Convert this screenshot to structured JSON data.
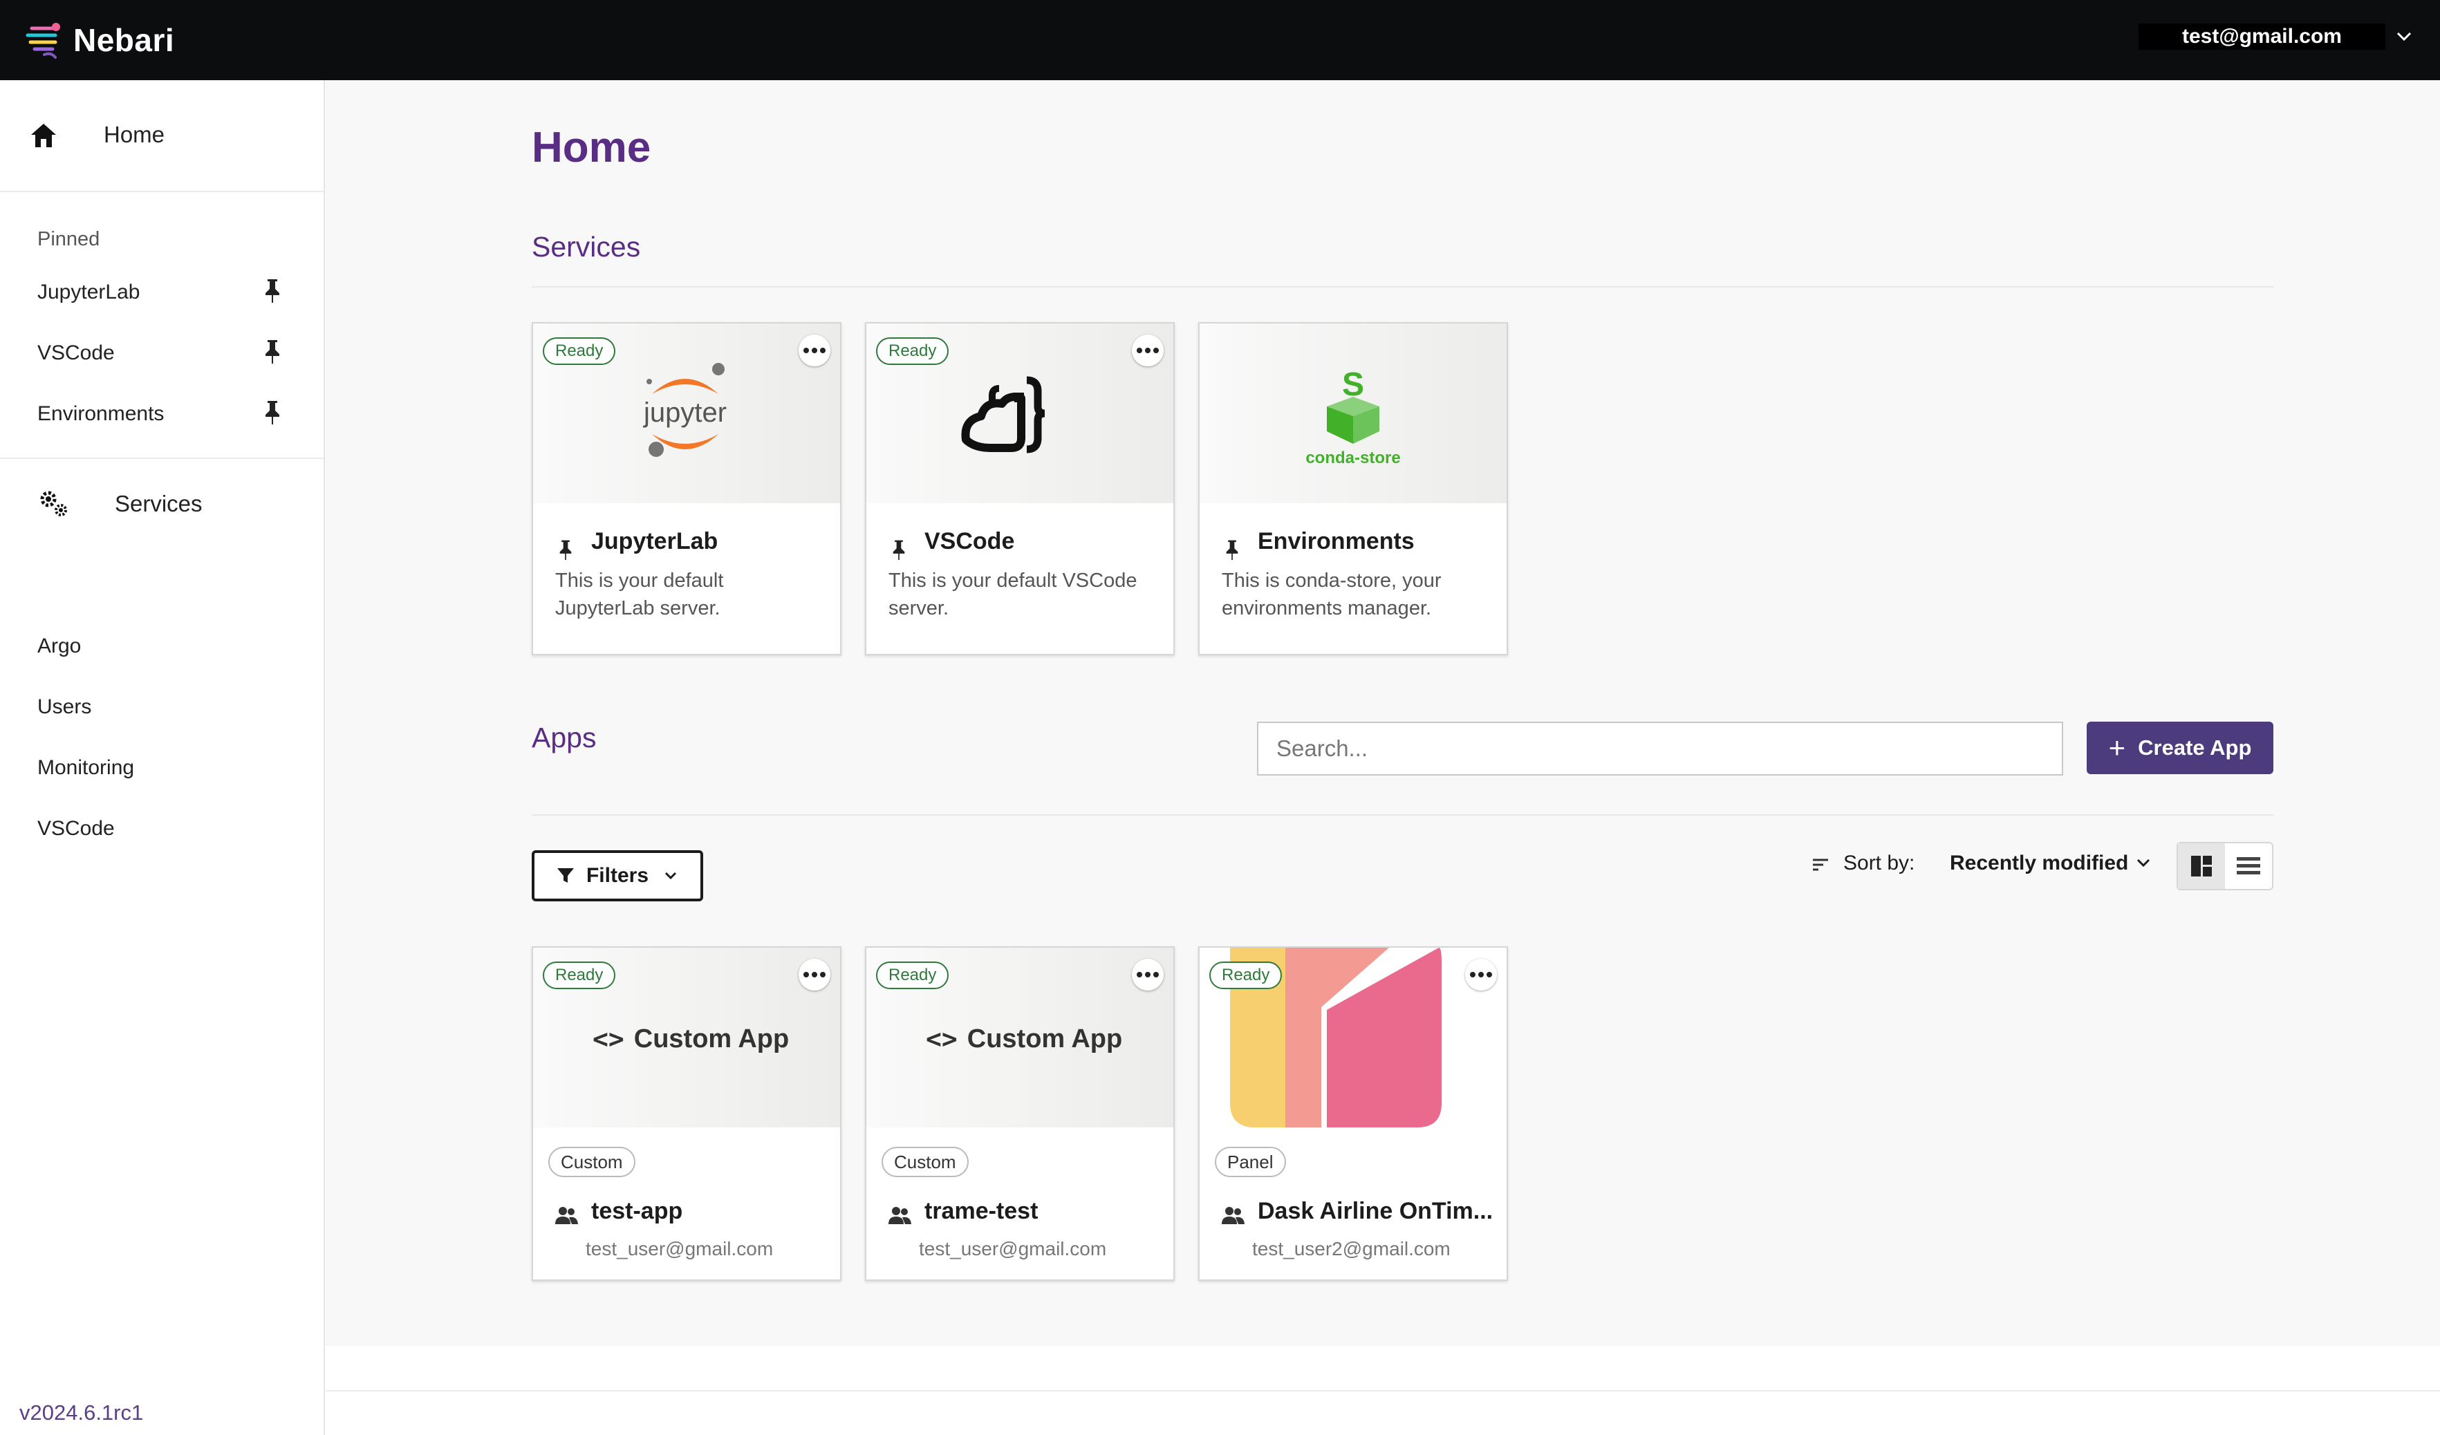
{
  "app": {
    "brand": "Nebari",
    "user_email": "test@gmail.com",
    "version": "v2024.6.1rc1"
  },
  "sidebar": {
    "home_label": "Home",
    "pinned_title": "Pinned",
    "pinned": [
      {
        "label": "JupyterLab"
      },
      {
        "label": "VSCode"
      },
      {
        "label": "Environments"
      }
    ],
    "services_title": "Services",
    "services": [
      {
        "label": "Argo"
      },
      {
        "label": "Users"
      },
      {
        "label": "Monitoring"
      },
      {
        "label": "VSCode"
      }
    ]
  },
  "main": {
    "title": "Home",
    "services_heading": "Services",
    "apps_heading": "Apps",
    "search_placeholder": "Search...",
    "create_app_label": "Create App",
    "filters_label": "Filters",
    "sort_label": "Sort by:",
    "sort_value": "Recently modified"
  },
  "services": [
    {
      "status": "Ready",
      "title": "JupyterLab",
      "description": "This is your default JupyterLab server.",
      "logo_text": "jupyter"
    },
    {
      "status": "Ready",
      "title": "VSCode",
      "description": "This is your default VSCode server."
    },
    {
      "status": "Ready",
      "title": "Environments",
      "description": "This is conda-store, your environments manager.",
      "logo_text": "conda-store"
    }
  ],
  "apps": [
    {
      "status": "Ready",
      "thumb_label": "Custom App",
      "framework": "Custom",
      "title": "test-app",
      "owner": "test_user@gmail.com"
    },
    {
      "status": "Ready",
      "thumb_label": "Custom App",
      "framework": "Custom",
      "title": "trame-test",
      "owner": "test_user@gmail.com"
    },
    {
      "status": "Ready",
      "framework": "Panel",
      "title": "Dask Airline OnTim...",
      "owner": "test_user2@gmail.com"
    }
  ],
  "colors": {
    "accent": "#5a2d85",
    "button": "#4c3b7d",
    "ready": "#2f7a3b",
    "topbar": "#0c0d0e"
  }
}
